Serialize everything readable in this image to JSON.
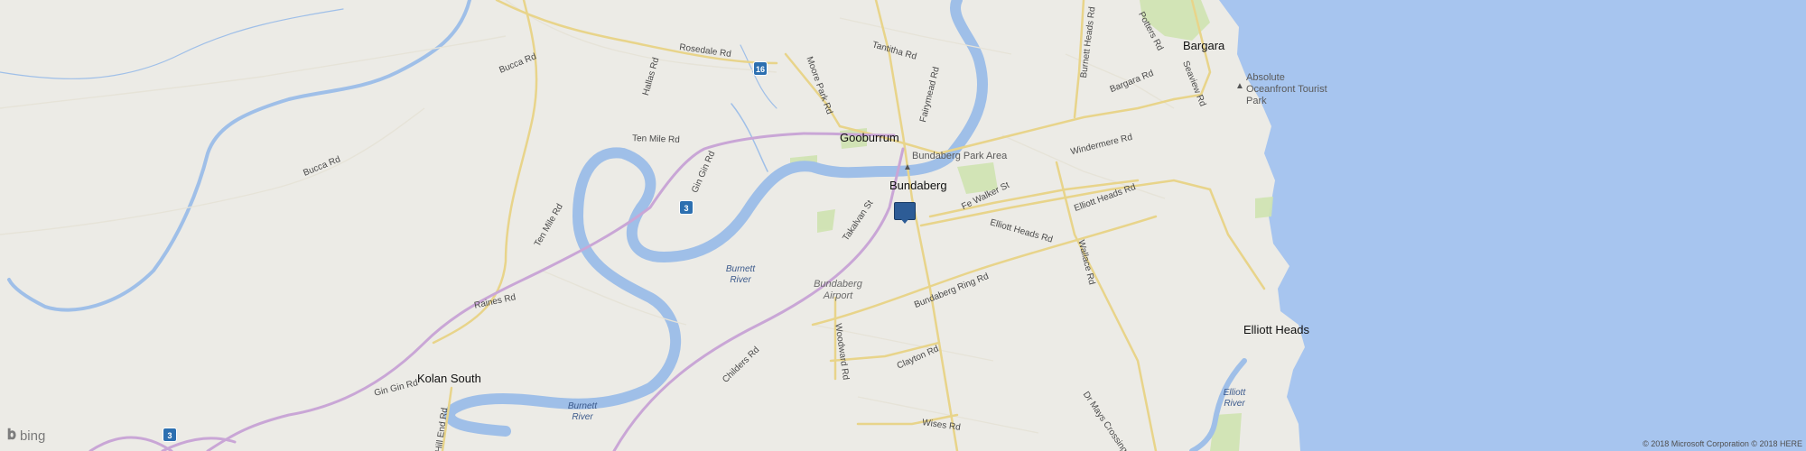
{
  "map": {
    "colors": {
      "land": "#ecebe6",
      "water": "#a7c5ef",
      "river": "#9fbfe8",
      "major_road": "#e8d48a",
      "highway": "#c9a6d6",
      "park": "#cfe3b0"
    },
    "places": {
      "bargara": "Bargara",
      "gooburrum": "Gooburrum",
      "bundaberg": "Bundaberg",
      "kolan_south": "Kolan South",
      "elliott_heads": "Elliott Heads"
    },
    "roads": {
      "rosedale": "Rosedale Rd",
      "bucca_top": "Bucca Rd",
      "bucca_mid": "Bucca Rd",
      "hallas": "Hallas Rd",
      "moore_park": "Moore Park Rd",
      "tantitha": "Tantitha Rd",
      "fairymead": "Fairymead Rd",
      "burnett_heads": "Burnett Heads Rd",
      "potters": "Potters Rd",
      "seaview": "Seaview Rd",
      "bargara_rd": "Bargara Rd",
      "windermere": "Windermere Rd",
      "ten_mile": "Ten Mile Rd",
      "ten_mile_rd2": "Ten Mile Rd",
      "gin_gin_rd": "Gin Gin Rd",
      "gin_gin_rd2": "Gin Gin Rd",
      "fe_walker": "Fe Walker St",
      "takalvan": "Takalvan St",
      "elliott_heads_rd1": "Elliott Heads Rd",
      "elliott_heads_rd2": "Elliott Heads Rd",
      "wallace": "Wallace Rd",
      "raines": "Raines Rd",
      "childers": "Childers Rd",
      "bundaberg_ring": "Bundaberg Ring Rd",
      "woodward": "Woodward Rd",
      "clayton": "Clayton Rd",
      "wises": "Wises Rd",
      "hill_end": "Hill End Rd",
      "dr_mays": "Dr Mays Crossing Rd"
    },
    "water_labels": {
      "burnett_river_1": "Burnett River",
      "burnett_river_2": "Burnett River",
      "elliott_river": "Elliott River"
    },
    "pois": {
      "park_area": "Bundaberg Park Area",
      "airport": "Bundaberg Airport",
      "tourist_park": "Absolute Oceanfront Tourist Park"
    },
    "shields": {
      "route_16": "16",
      "route_3a": "3",
      "route_3b": "3"
    },
    "branding": {
      "logo_text": "bing"
    },
    "copyright": "© 2018 Microsoft Corporation © 2018 HERE"
  }
}
